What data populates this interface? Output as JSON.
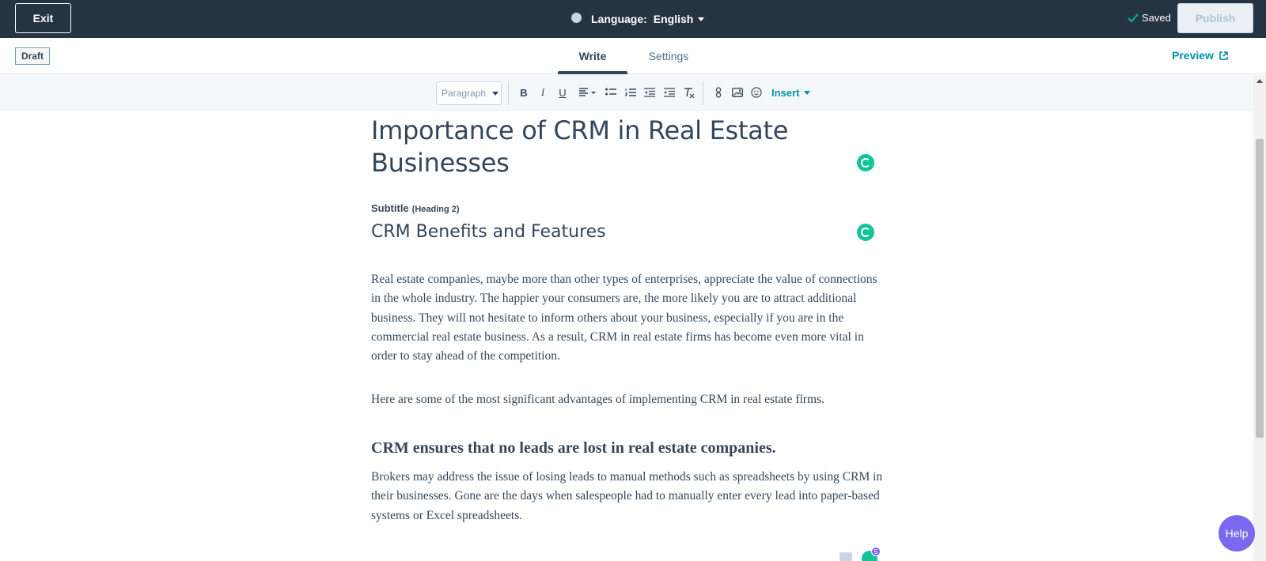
{
  "topbar": {
    "exit_label": "Exit",
    "language_label": "Language:",
    "language_value": "English",
    "saved_label": "Saved",
    "publish_label": "Publish"
  },
  "subbar": {
    "status_badge": "Draft",
    "tabs": [
      {
        "label": "Write",
        "active": true
      },
      {
        "label": "Settings",
        "active": false
      }
    ],
    "preview_label": "Preview"
  },
  "toolbar": {
    "paragraph_select": "Paragraph",
    "bold": "B",
    "italic": "I",
    "underline": "U",
    "insert_label": "Insert",
    "icons": [
      "bold-icon",
      "italic-icon",
      "underline-icon",
      "align-icon",
      "bulleted-list-icon",
      "numbered-list-icon",
      "outdent-icon",
      "indent-icon",
      "clear-format-icon",
      "link-icon",
      "image-icon",
      "emoji-icon"
    ]
  },
  "content": {
    "title": "Importance of CRM in Real Estate Businesses",
    "subtitle_label": "Subtitle",
    "subtitle_hint": "(Heading 2)",
    "subtitle": "CRM Benefits and Features",
    "paragraph1": "Real estate companies, maybe more than other types of enterprises, appreciate the value of connections in the whole industry. The happier your consumers are, the more likely you are to attract additional business. They will not hesitate to inform others about your business, especially if you are in the commercial real estate business. As a result, CRM in real estate firms has become even more vital in order to stay ahead of the competition.",
    "paragraph2": "Here are some of the most significant advantages of implementing CRM in real estate firms.",
    "heading3": "CRM ensures that no leads are lost in real estate companies.",
    "paragraph3": "Brokers may address the issue of losing leads to manual methods such as spreadsheets by using CRM in their businesses. Gone are the days when salespeople had to manually enter every lead into paper-based systems or Excel spreadsheets."
  },
  "help_label": "Help",
  "grammarly_badge_count": "5",
  "colors": {
    "topbar_bg": "#253342",
    "accent_link": "#0091ae",
    "grammarly_green": "#15c39a",
    "help_purple": "#7b68ee"
  }
}
